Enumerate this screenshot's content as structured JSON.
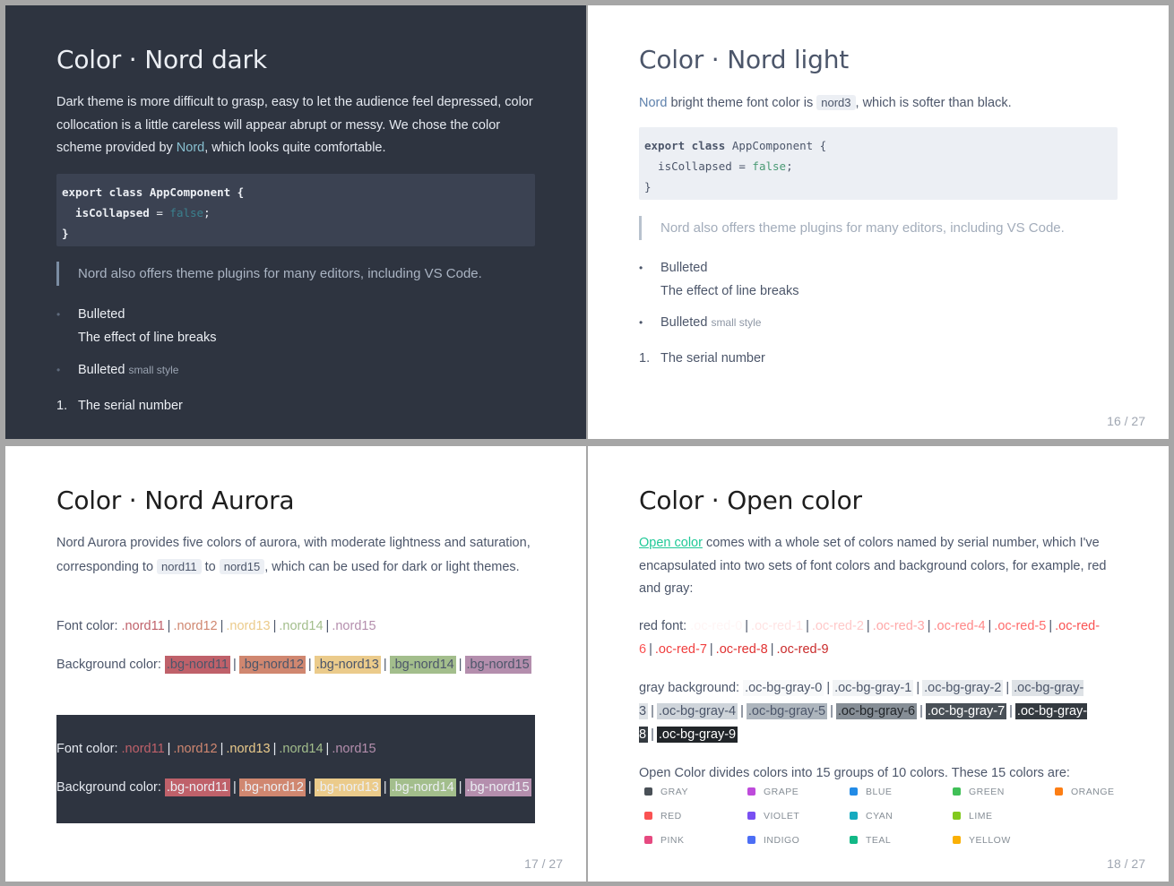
{
  "slides": {
    "nord_dark": {
      "title": "Color · Nord dark",
      "para_pre": "Dark theme is more difficult to grasp, easy to let the audience feel depressed, color collocation is a little careless will appear abrupt or messy. We chose the color scheme provided by ",
      "para_link": "Nord",
      "para_post": ", which looks quite comfortable.",
      "code": {
        "kw1": "export class",
        "cls": " AppComponent {",
        "prop": "  isCollapsed",
        "eq": " = ",
        "val": "false",
        "semi": ";",
        "close": "}"
      },
      "quote": "Nord also offers theme plugins for many editors, including VS Code.",
      "bullet_glyph": "•",
      "item1": "Bulleted",
      "item1_line2": "The effect of line breaks",
      "item2": "Bulleted",
      "item2_small": "small style",
      "num1": "1.",
      "ordered1": "The serial number"
    },
    "nord_light": {
      "title": "Color · Nord light",
      "para_link": "Nord",
      "para_mid": " bright theme font color is ",
      "para_code": "nord3",
      "para_post": ", which is softer than black.",
      "code": {
        "kw1": "export class",
        "cls": " AppComponent {",
        "prop": "  isCollapsed",
        "eq": " = ",
        "val": "false",
        "semi": ";",
        "close": "}"
      },
      "quote": "Nord also offers theme plugins for many editors, including VS Code.",
      "bullet_glyph": "•",
      "item1": "Bulleted",
      "item1_line2": "The effect of line breaks",
      "item2": "Bulleted",
      "item2_small": "small style",
      "num1": "1.",
      "ordered1": "The serial number",
      "page": "16 / 27"
    },
    "nord_aurora": {
      "title": "Color · Nord Aurora",
      "para_pre": "Nord Aurora provides five colors of aurora, with moderate lightness and saturation, corresponding to ",
      "code1": "nord11",
      "to": " to ",
      "code2": "nord15",
      "para_post": ", which can be used for dark or light themes.",
      "font_label": "Font color: ",
      "bg_label": "Background color: ",
      "sep": "|",
      "fonts": [
        ".nord11",
        ".nord12",
        ".nord13",
        ".nord14",
        ".nord15"
      ],
      "bgs": [
        ".bg-nord11",
        ".bg-nord12",
        ".bg-nord13",
        ".bg-nord14",
        ".bg-nord15"
      ],
      "colors": {
        "nord11": "#bf616a",
        "nord12": "#d08770",
        "nord13": "#ebcb8b",
        "nord14": "#a3be8c",
        "nord15": "#b48ead"
      },
      "page": "17 / 27"
    },
    "open_color": {
      "title": "Color · Open color",
      "para_link": "Open color",
      "para_post": " comes with a whole set of colors named by serial number, which I've encapsulated into two sets of font colors and background colors, for example, red and gray:",
      "red_label": "red font: ",
      "reds": [
        ".oc-red-0",
        ".oc-red-1",
        ".oc-red-2",
        ".oc-red-3",
        ".oc-red-4",
        ".oc-red-5",
        ".oc-red-6",
        ".oc-red-7",
        ".oc-red-8",
        ".oc-red-9"
      ],
      "gray_label": "gray background: ",
      "grays": [
        ".oc-bg-gray-0",
        ".oc-bg-gray-1",
        ".oc-bg-gray-2",
        ".oc-bg-gray-3",
        ".oc-bg-gray-4",
        ".oc-bg-gray-5",
        ".oc-bg-gray-6",
        ".oc-bg-gray-7",
        ".oc-bg-gray-8",
        ".oc-bg-gray-9"
      ],
      "groups_text": "Open Color divides colors into 15 groups of 10 colors. These 15 colors are:",
      "groups": [
        {
          "name": "GRAY",
          "color": "#495057"
        },
        {
          "name": "GRAPE",
          "color": "#be4bdb"
        },
        {
          "name": "BLUE",
          "color": "#228be6"
        },
        {
          "name": "GREEN",
          "color": "#40c057"
        },
        {
          "name": "ORANGE",
          "color": "#fd7e14"
        },
        {
          "name": "RED",
          "color": "#fa5252"
        },
        {
          "name": "VIOLET",
          "color": "#7950f2"
        },
        {
          "name": "CYAN",
          "color": "#15aabf"
        },
        {
          "name": "LIME",
          "color": "#82c91e"
        },
        {
          "name": "PINK",
          "color": "#e64980"
        },
        {
          "name": "INDIGO",
          "color": "#4c6ef5"
        },
        {
          "name": "TEAL",
          "color": "#12b886"
        },
        {
          "name": "YELLOW",
          "color": "#fab005"
        }
      ],
      "page": "18 / 27"
    }
  }
}
